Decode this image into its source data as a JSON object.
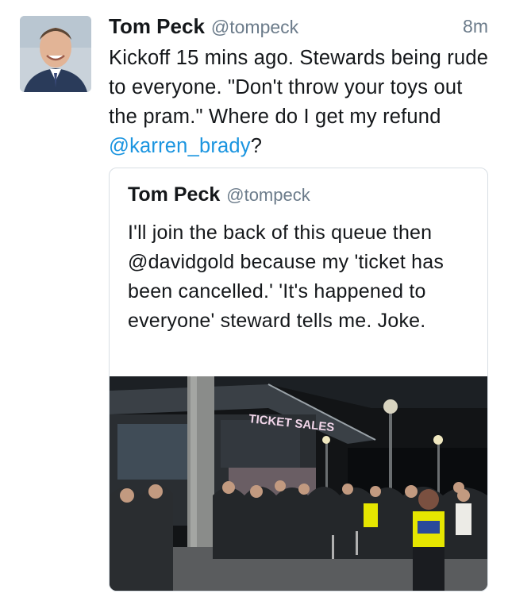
{
  "tweet": {
    "name": "Tom Peck",
    "handle": "@tompeck",
    "time": "8m",
    "text_before": "Kickoff 15 mins ago. Stewards being rude to everyone. \"Don't throw your toys out the pram.\" Where do I get my refund ",
    "mention": "@karren_brady",
    "text_after": "?"
  },
  "quoted_tweet": {
    "name": "Tom Peck",
    "handle": "@tompeck",
    "text": "I'll join the back of this queue then @davidgold because my 'ticket has been cancelled.' 'It's happened to everyone' steward tells me. Joke.",
    "photo": {
      "sign_text": "TICKET SALES"
    }
  },
  "colors": {
    "mention": "#1b95e0",
    "secondary_text": "#6b7b8a",
    "card_border": "#d8dee4",
    "hi_vis_vest": "#e6e600"
  }
}
